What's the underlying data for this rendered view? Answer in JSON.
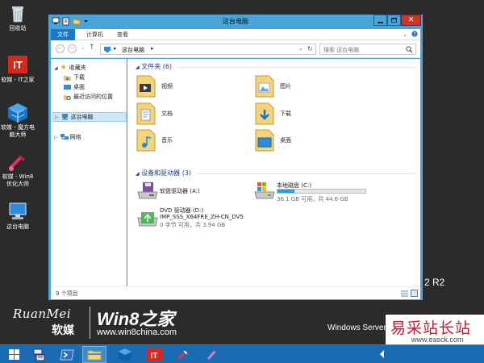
{
  "desktop": {
    "icons": [
      {
        "label": "回收站",
        "icon": "recycle-bin-icon"
      },
      {
        "label": "软媒 - IT之家",
        "icon": "ithome-icon"
      },
      {
        "label": "软媒 - 魔方电脑大师",
        "icon": "mofang-icon"
      },
      {
        "label": "软媒 - Win8优化大师",
        "icon": "win8-optimizer-icon"
      },
      {
        "label": "这台电脑",
        "icon": "this-pc-icon"
      }
    ],
    "brand_ruanmei": "RuanMei",
    "brand_ruanmei_cn": "软媒",
    "brand_win8": "Win8之家",
    "brand_url": "www.win8china.com",
    "os_name": "Windows Server 2",
    "os_suffix": "2 R2"
  },
  "watermark": {
    "title": "易采站长站",
    "url": "www.easck.com"
  },
  "window": {
    "title": "这台电脑",
    "quick_access_icons": [
      "computer-icon",
      "properties-icon",
      "new-folder-icon",
      "dropdown-icon"
    ],
    "ribbon_tabs": [
      "文件",
      "计算机",
      "查看"
    ],
    "nav": {
      "back_icon": "back-arrow-icon",
      "forward_icon": "forward-arrow-icon",
      "up_icon": "up-arrow-icon",
      "breadcrumb": "这台电脑",
      "refresh_icon": "refresh-icon",
      "search_placeholder": "搜索 这台电脑"
    },
    "sidebar": {
      "favorites": "收藏夹",
      "favorite_items": [
        "下载",
        "桌面",
        "最近访问的位置"
      ],
      "this_pc": "这台电脑",
      "network": "网络"
    },
    "folders_header": "文件夹 (6)",
    "folders": [
      "视频",
      "图片",
      "文档",
      "下载",
      "音乐",
      "桌面"
    ],
    "devices_header": "设备和驱动器 (3)",
    "devices": [
      {
        "name": "软盘驱动器 (A:)",
        "icon": "floppy-drive-icon"
      },
      {
        "name": "本地磁盘 (C:)",
        "free": "36.1 GB 可用，共 44.6 GB",
        "used_fraction": 0.19,
        "icon": "local-disk-icon"
      },
      {
        "name": "DVD 驱动器 (D:)",
        "label": "IMP_SSS_X64FRE_ZH-CN_DV5",
        "free": "0 字节 可用，共 3.94 GB",
        "icon": "dvd-drive-icon"
      }
    ],
    "status": "9 个项目",
    "colors": {
      "accent": "#1979ca",
      "frame": "#4aa4d8",
      "close": "#c7372c",
      "header_text": "#1e3d8f"
    }
  },
  "taskbar": {
    "items": [
      "start-icon",
      "server-manager-icon",
      "powershell-icon",
      "file-explorer-icon",
      "mofang-icon",
      "ithome-icon",
      "win8-optimizer-icon",
      "paint-brush-icon"
    ]
  }
}
